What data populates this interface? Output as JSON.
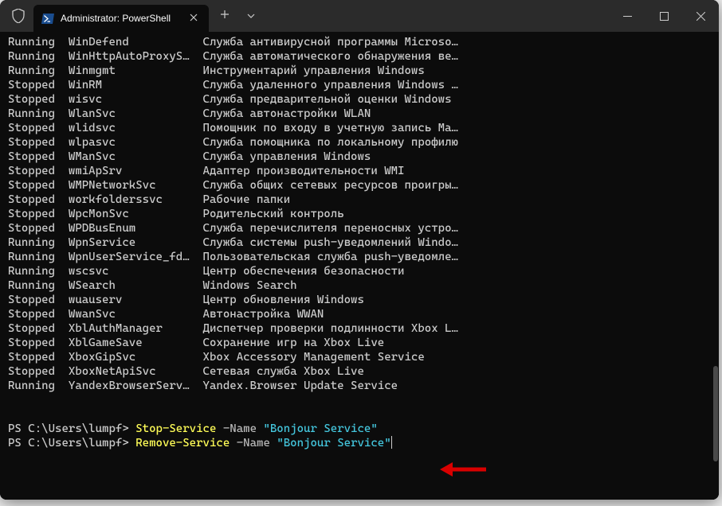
{
  "titlebar": {
    "tab_title": "Administrator: PowerShell"
  },
  "services": [
    {
      "status": "Running",
      "name": "WinDefend",
      "desc": "Служба антивирусной программы Microso…"
    },
    {
      "status": "Running",
      "name": "WinHttpAutoProxyS…",
      "desc": "Служба автоматического обнаружения ве…"
    },
    {
      "status": "Running",
      "name": "Winmgmt",
      "desc": "Инструментарий управления Windows"
    },
    {
      "status": "Stopped",
      "name": "WinRM",
      "desc": "Служба удаленного управления Windows …"
    },
    {
      "status": "Stopped",
      "name": "wisvc",
      "desc": "Служба предварительной оценки Windows"
    },
    {
      "status": "Running",
      "name": "WlanSvc",
      "desc": "Служба автонастройки WLAN"
    },
    {
      "status": "Stopped",
      "name": "wlidsvc",
      "desc": "Помощник по входу в учетную запись Ma…"
    },
    {
      "status": "Stopped",
      "name": "wlpasvc",
      "desc": "Служба помощника по локальному профилю"
    },
    {
      "status": "Stopped",
      "name": "WManSvc",
      "desc": "Служба управления Windows"
    },
    {
      "status": "Stopped",
      "name": "wmiApSrv",
      "desc": "Адаптер производительности WMI"
    },
    {
      "status": "Stopped",
      "name": "WMPNetworkSvc",
      "desc": "Служба общих сетевых ресурсов проигры…"
    },
    {
      "status": "Stopped",
      "name": "workfolderssvc",
      "desc": "Рабочие папки"
    },
    {
      "status": "Stopped",
      "name": "WpcMonSvc",
      "desc": "Родительский контроль"
    },
    {
      "status": "Stopped",
      "name": "WPDBusEnum",
      "desc": "Служба перечислителя переносных устро…"
    },
    {
      "status": "Running",
      "name": "WpnService",
      "desc": "Служба системы push-уведомлений Windo…"
    },
    {
      "status": "Running",
      "name": "WpnUserService_fd…",
      "desc": "Пользовательская служба push-уведомле…"
    },
    {
      "status": "Running",
      "name": "wscsvc",
      "desc": "Центр обеспечения безопасности"
    },
    {
      "status": "Running",
      "name": "WSearch",
      "desc": "Windows Search"
    },
    {
      "status": "Stopped",
      "name": "wuauserv",
      "desc": "Центр обновления Windows"
    },
    {
      "status": "Stopped",
      "name": "WwanSvc",
      "desc": "Автонастройка WWAN"
    },
    {
      "status": "Stopped",
      "name": "XblAuthManager",
      "desc": "Диспетчер проверки подлинности Xbox L…"
    },
    {
      "status": "Stopped",
      "name": "XblGameSave",
      "desc": "Сохранение игр на Xbox Live"
    },
    {
      "status": "Stopped",
      "name": "XboxGipSvc",
      "desc": "Xbox Accessory Management Service"
    },
    {
      "status": "Stopped",
      "name": "XboxNetApiSvc",
      "desc": "Сетевая служба Xbox Live"
    },
    {
      "status": "Running",
      "name": "YandexBrowserServ…",
      "desc": "Yandex.Browser Update Service"
    }
  ],
  "prompts": [
    {
      "path": "PS C:\\Users\\lumpf> ",
      "cmd": "Stop-Service",
      "param": " -Name ",
      "str": "\"Bonjour Service\""
    },
    {
      "path": "PS C:\\Users\\lumpf> ",
      "cmd": "Remove-Service",
      "param": " -Name ",
      "str": "\"Bonjour Service\""
    }
  ]
}
